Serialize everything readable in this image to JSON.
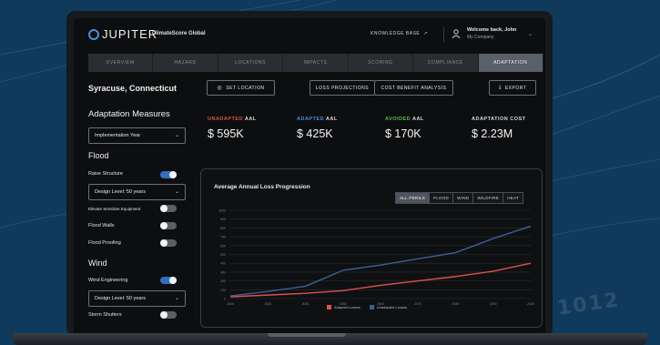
{
  "app": {
    "logo_text": "JUPITER",
    "product": "ClimateScore Global",
    "knowledge_base": "KNOWLEDGE BASE",
    "welcome": "Welcome back, John",
    "company": "My Company"
  },
  "nav": {
    "tabs": [
      "OVERVIEW",
      "HAZARD",
      "LOCATIONS",
      "IMPACTS",
      "SCORING",
      "COMPLIANCE",
      "ADAPTATION"
    ],
    "active": "ADAPTATION"
  },
  "location": {
    "name": "Syracuse, Connecticut",
    "set_location": "SET LOCATION",
    "loss_projections": "LOSS PROJECTIONS",
    "cost_benefit": "COST BENEFIT ANALYSIS",
    "export": "EXPORT"
  },
  "measures": {
    "title": "Adaptation Measures",
    "year_select": "Implementation Year",
    "flood": {
      "title": "Flood",
      "raise_structure": "Raise Structure",
      "raise_structure_on": true,
      "design_level": "Design Level: 50 years",
      "elevate_equipment": "Elevate Sensitive Equipment",
      "elevate_equipment_on": false,
      "flood_walls": "Flood Walls",
      "flood_walls_on": false,
      "flood_proofing": "Flood Proofing",
      "flood_proofing_on": false
    },
    "wind": {
      "title": "Wind",
      "wind_engineering": "Wind Engineering",
      "wind_engineering_on": true,
      "design_level": "Design Level: 50 years",
      "storm_shutters": "Storm Shutters",
      "storm_shutters_on": false
    }
  },
  "metrics": [
    {
      "label_accent": "UNADAPTED",
      "label_rest": " AAL",
      "accent_color": "#d9534f",
      "value": "$ 595K"
    },
    {
      "label_accent": "ADAPTED",
      "label_rest": " AAL",
      "accent_color": "#4a90d9",
      "value": "$ 425K"
    },
    {
      "label_accent": "AVOIDED",
      "label_rest": " AAL",
      "accent_color": "#5cb85c",
      "value": "$ 170K"
    },
    {
      "label_accent": "",
      "label_rest": "ADAPTATION COST",
      "accent_color": "#d9dce0",
      "value": "$ 2.23M"
    }
  ],
  "chart_panel": {
    "title": "Average Annual Loss Progression",
    "filters": [
      "ALL PERILS",
      "FLOOD",
      "WIND",
      "WILDFIRE",
      "HEAT"
    ],
    "active_filter": "ALL PERILS"
  },
  "chart_data": {
    "type": "line",
    "title": "Average Annual Loss Progression",
    "x": [
      2020,
      2030,
      2040,
      2050,
      2060,
      2070,
      2080,
      2090,
      2100
    ],
    "ylim": [
      0,
      1000
    ],
    "yticks": [
      0,
      100,
      200,
      300,
      400,
      500,
      600,
      700,
      800,
      900,
      1000
    ],
    "grid": true,
    "legend_position": "bottom",
    "series": [
      {
        "name": "Adapted Losses",
        "color": "#d9534f",
        "values": [
          20,
          40,
          60,
          90,
          150,
          200,
          250,
          310,
          400
        ]
      },
      {
        "name": "Unadapted Losses",
        "color": "#3d5f99",
        "values": [
          30,
          80,
          140,
          320,
          380,
          450,
          520,
          680,
          820
        ]
      }
    ]
  },
  "watermark": "1012"
}
